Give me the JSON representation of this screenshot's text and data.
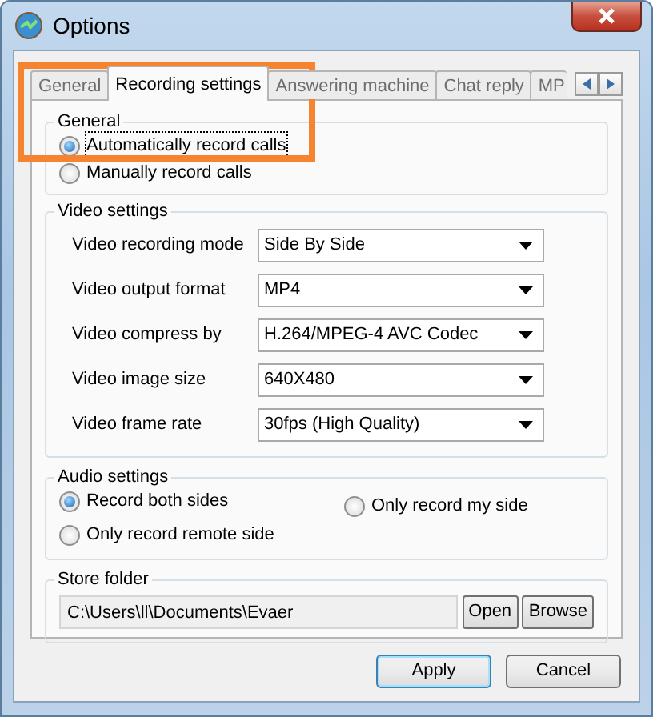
{
  "window": {
    "title": "Options"
  },
  "tabs": [
    {
      "label": "General",
      "selected": false
    },
    {
      "label": "Recording settings",
      "selected": true
    },
    {
      "label": "Answering machine",
      "selected": false
    },
    {
      "label": "Chat reply",
      "selected": false
    },
    {
      "label": "MP",
      "selected": false
    }
  ],
  "general": {
    "title": "General",
    "options": [
      {
        "label": "Automatically record calls",
        "selected": true,
        "focused": true
      },
      {
        "label": "Manually record calls",
        "selected": false,
        "focused": false
      }
    ]
  },
  "video_settings": {
    "title": "Video settings",
    "rows": [
      {
        "label": "Video recording mode",
        "value": "Side By Side"
      },
      {
        "label": "Video output format",
        "value": "MP4"
      },
      {
        "label": "Video compress by",
        "value": "H.264/MPEG-4 AVC Codec"
      },
      {
        "label": "Video image size",
        "value": "640X480"
      },
      {
        "label": "Video frame rate",
        "value": "30fps (High Quality)"
      }
    ]
  },
  "audio_settings": {
    "title": "Audio settings",
    "options": [
      {
        "label": "Record both sides",
        "selected": true
      },
      {
        "label": "Only record my side",
        "selected": false
      },
      {
        "label": "Only record remote side",
        "selected": false
      }
    ]
  },
  "store_folder": {
    "title": "Store folder",
    "path": "C:\\Users\\ll\\Documents\\Evaer",
    "buttons": [
      "Open",
      "Browse"
    ]
  },
  "buttons": [
    {
      "label": "Apply",
      "default": true
    },
    {
      "label": "Cancel",
      "default": false
    }
  ]
}
